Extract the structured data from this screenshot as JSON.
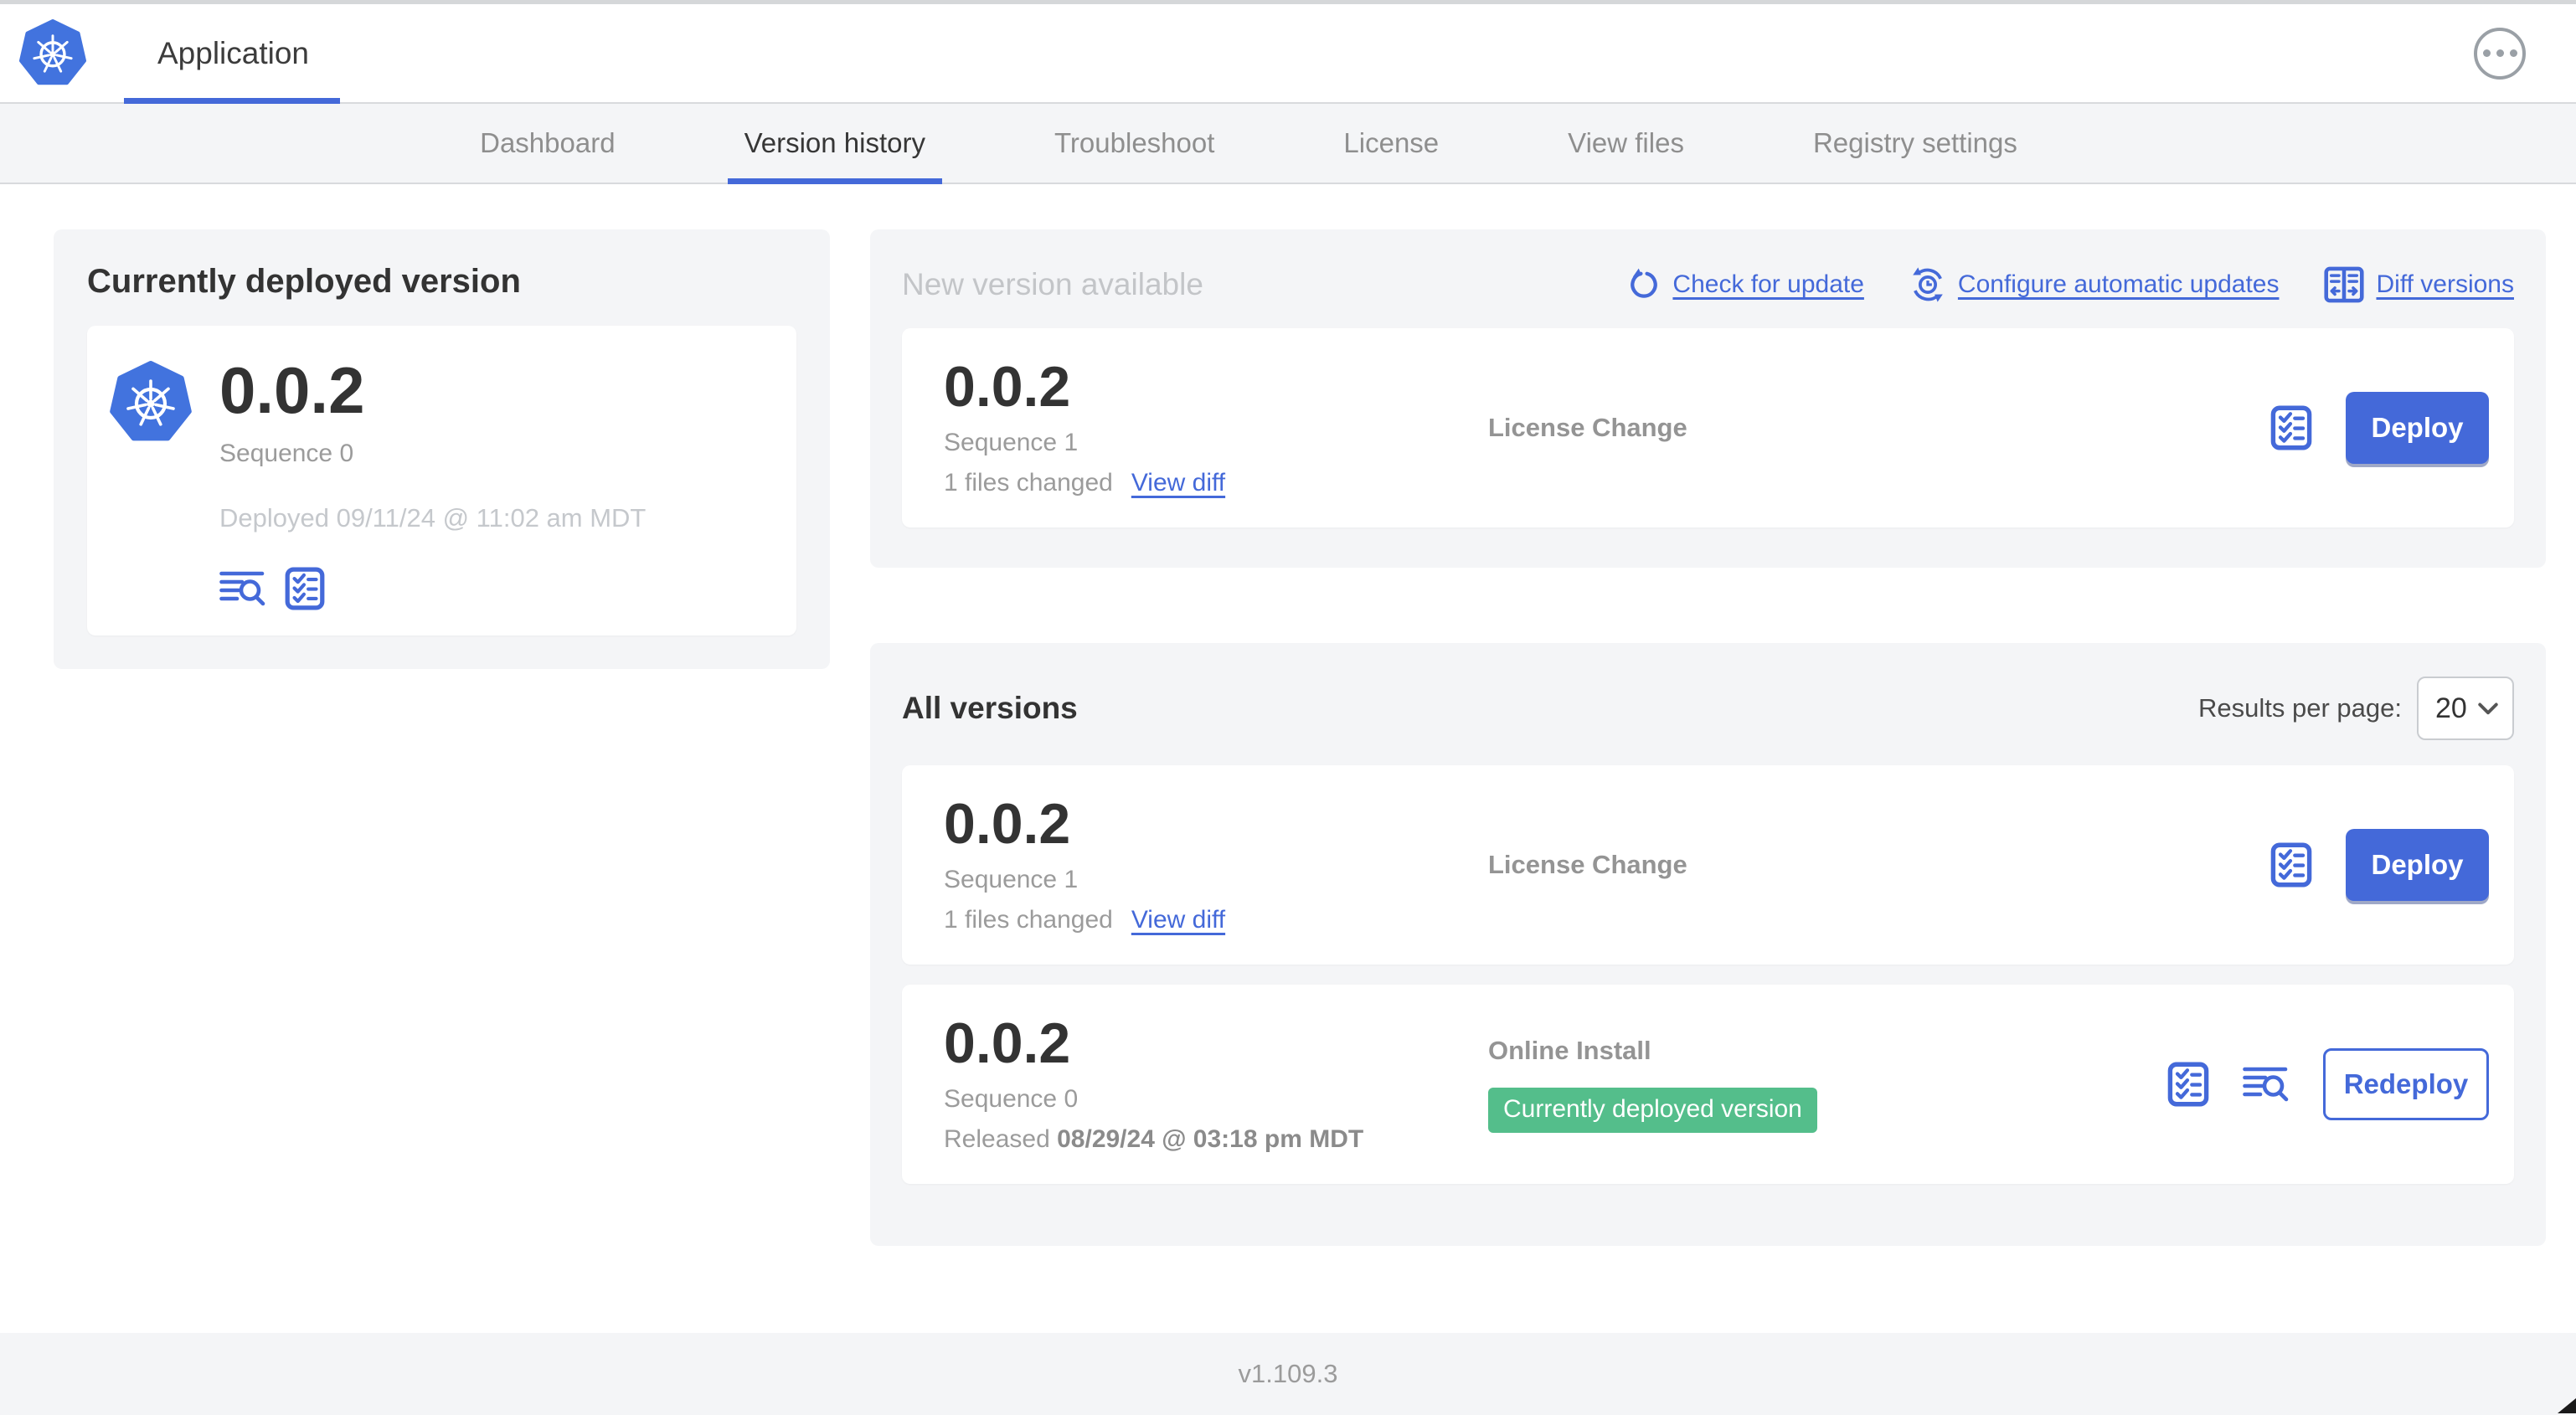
{
  "colors": {
    "primary-blue": "#4469D9",
    "logo-blue": "#4273DE",
    "badge-green": "#54BE8B",
    "panel-gray": "#F4F5F7",
    "border-gray": "#D8DADD",
    "text-dark": "#333333",
    "text-gray": "#9B9B9B",
    "text-light": "#C5C8CC",
    "nav-inactive": "#8E8E8E"
  },
  "header": {
    "app_title": "Application"
  },
  "nav": {
    "tabs": [
      {
        "label": "Dashboard"
      },
      {
        "label": "Version history"
      },
      {
        "label": "Troubleshoot"
      },
      {
        "label": "License"
      },
      {
        "label": "View files"
      },
      {
        "label": "Registry settings"
      }
    ],
    "active": "Version history"
  },
  "current_deployed": {
    "title": "Currently deployed version",
    "version": "0.0.2",
    "sequence": "Sequence 0",
    "deployed": "Deployed 09/11/24 @ 11:02 am MDT"
  },
  "new_version": {
    "title": "New version available",
    "check_link": "Check for update",
    "configure_link": "Configure automatic updates",
    "diff_link": "Diff versions",
    "row": {
      "version": "0.0.2",
      "sequence": "Sequence 1",
      "files_changed": "1 files changed",
      "view_diff": "View diff",
      "source": "License Change",
      "action": "Deploy"
    }
  },
  "all_versions": {
    "title": "All versions",
    "results_label": "Results per page:",
    "results_value": "20",
    "rows": [
      {
        "version": "0.0.2",
        "sequence": "Sequence 1",
        "files_changed": "1 files changed",
        "view_diff": "View diff",
        "source": "License Change",
        "action": "Deploy"
      },
      {
        "version": "0.0.2",
        "sequence": "Sequence 0",
        "released_label": "Released",
        "released_value": "08/29/24 @ 03:18 pm MDT",
        "source": "Online Install",
        "badge": "Currently deployed version",
        "action": "Redeploy"
      }
    ]
  },
  "footer": {
    "version": "v1.109.3"
  }
}
